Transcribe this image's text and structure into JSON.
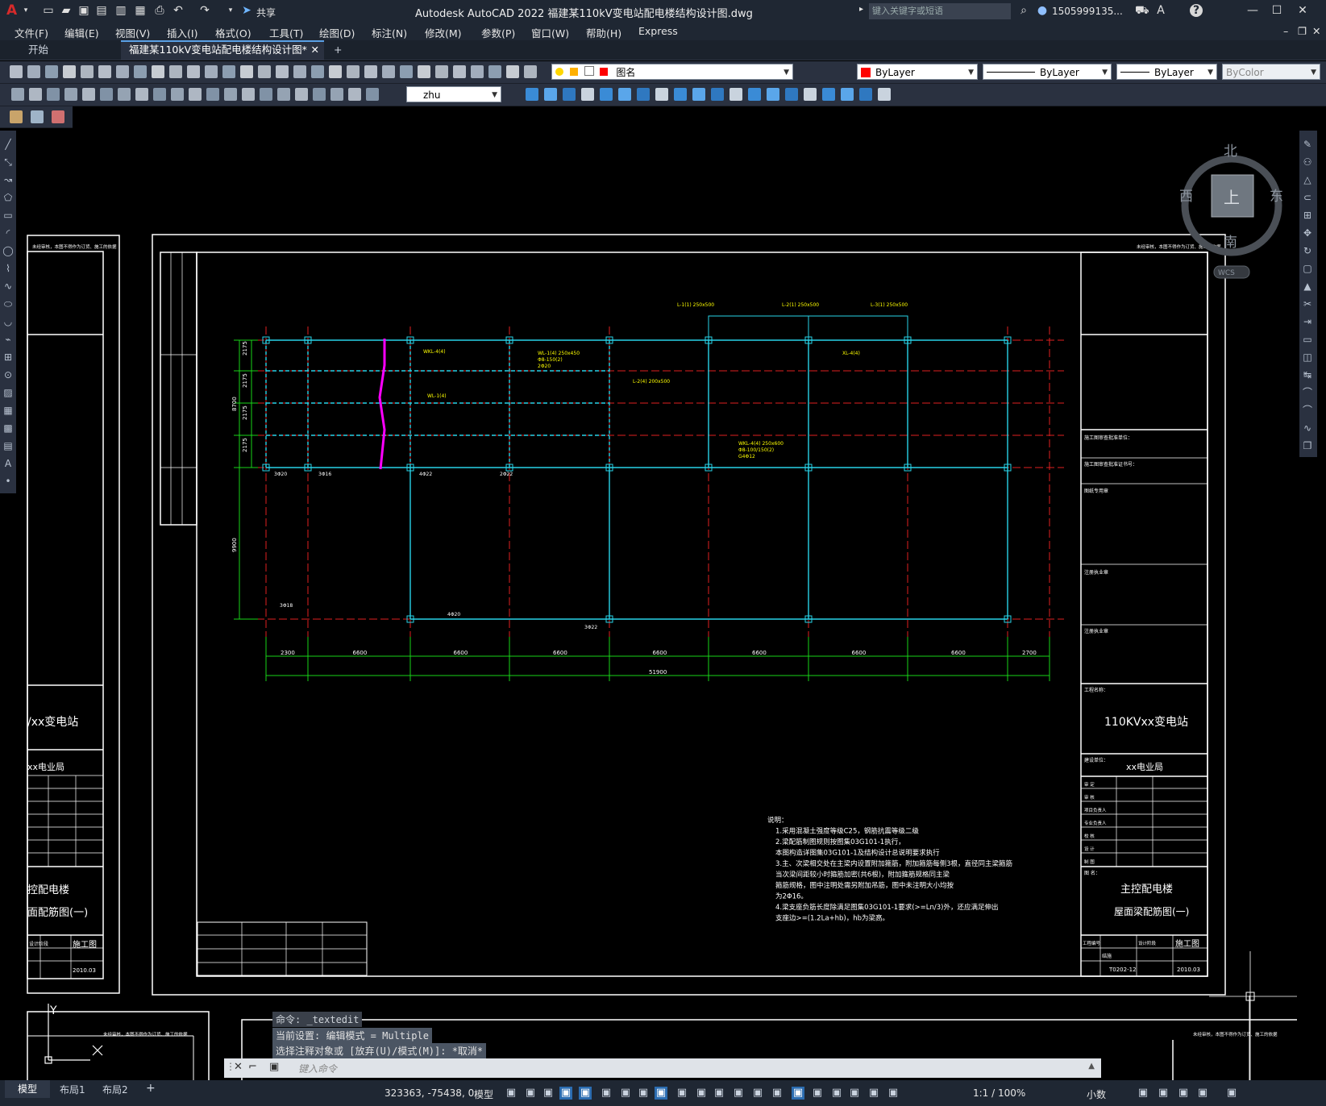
{
  "titlebar": {
    "app_logo": "A",
    "share_label": "共享",
    "title": "Autodesk AutoCAD 2022    福建某110kV变电站配电楼结构设计图.dwg",
    "search_placeholder": "键入关键字或短语",
    "user": "1505999135..."
  },
  "menu": [
    "文件(F)",
    "编辑(E)",
    "视图(V)",
    "插入(I)",
    "格式(O)",
    "工具(T)",
    "绘图(D)",
    "标注(N)",
    "修改(M)",
    "参数(P)",
    "窗口(W)",
    "帮助(H)",
    "Express"
  ],
  "tabs": {
    "start": "开始",
    "active": "福建某110kV变电站配电楼结构设计图*",
    "add": "+"
  },
  "toolbar": {
    "layer_name": "图名",
    "color": "ByLayer",
    "linetype": "ByLayer",
    "lineweight": "ByLayer",
    "plotstyle": "ByColor",
    "dimstyle": "zhu"
  },
  "viewcube": {
    "north": "北",
    "south": "南",
    "east": "东",
    "west": "西",
    "top": "上",
    "wcs": "WCS"
  },
  "drawing": {
    "note_small": "未经审核，本图不得作为订货、施工的依据",
    "dims_bottom": [
      "2300",
      "6600",
      "6600",
      "6600",
      "6600",
      "6600",
      "6600",
      "6600",
      "2700"
    ],
    "dim_total": "51900",
    "dims_left": [
      "2175",
      "2175",
      "2175",
      "2175"
    ],
    "dim_left_total": "8700",
    "dim_left_lower": "9900",
    "beam_labels": [
      "WKL-4(4)",
      "WL-1(4) 250x450",
      "Φ8-150(2)",
      "2Φ20",
      "L-2(4) 200x500",
      "WL-1(4)",
      "WKL-4(4) 250x600",
      "Φ8-100/150(2)",
      "G4Φ12",
      "XL-4(4)",
      "L-1(1) 250x500",
      "L-2(1) 250x500",
      "L-3(1) 250x500"
    ],
    "rebar_labels": [
      "3Φ20",
      "3Φ16",
      "4Φ22",
      "2Φ22",
      "3Φ18",
      "4Φ20",
      "3Φ22"
    ],
    "panel_left": {
      "station": "/xx变电站",
      "bureau": "xx电业局",
      "drawing_name_1": "控配电楼",
      "drawing_name_2": "面配筋图(一)",
      "stage": "施工图",
      "date": "2010.03",
      "col_label": "设计阶段"
    },
    "panel_right": {
      "header1": "施工图审查批准单位：",
      "header2": "施工图审查批准证书号：",
      "header3": "图纸专用章",
      "header4": "注册执业章",
      "header5": "注册执业章",
      "project_label": "工程名称：",
      "station": "110KVxx变电站",
      "client_label": "建设单位：",
      "bureau": "xx电业局",
      "roles": [
        "审 定",
        "审 核",
        "项目负责人",
        "专业负责人",
        "校 核",
        "设 计",
        "制 图"
      ],
      "drawing_label": "图 名：",
      "drawing_name_1": "主控配电楼",
      "drawing_name_2": "屋面梁配筋图(一)",
      "code_label": "工程编号",
      "stage_label": "设计阶段",
      "stage": "施工图",
      "type": "结施",
      "num": "T0202-12",
      "date": "2010.03"
    },
    "notes": [
      "说明：",
      "1.采用混凝土强度等级C25，钢筋抗震等级二级",
      "2.梁配筋制图规则按图集03G101-1执行，",
      "  本图构造详图集03G101-1及结构设计总说明要求执行",
      "3.主、次梁相交处在主梁内设置附加箍筋，附加箍筋每侧3根，直径同主梁箍筋",
      "  当次梁间距较小时箍筋加密(共6根)，附加箍筋规格同主梁",
      "  箍筋规格，图中注明处需另附加吊筋，图中未注明大小均按",
      "  为2Φ16。",
      "4.梁支座负筋长度除满足图集03G101-1要求(>=Ln/3)外，还应满足伸出",
      "  支座边>=(1.2La+hb)，hb为梁高。"
    ]
  },
  "command": {
    "history": [
      "命令: _textedit",
      "当前设置: 编辑模式 = Multiple",
      "选择注释对象或 [放弃(U)/模式(M)]: *取消*"
    ],
    "placeholder": "键入命令"
  },
  "status": {
    "layouts": [
      "模型",
      "布局1",
      "布局2"
    ],
    "coords": "323363, -75438, 0",
    "space": "模型",
    "scale": "1:1 / 100%",
    "units": "小数"
  }
}
